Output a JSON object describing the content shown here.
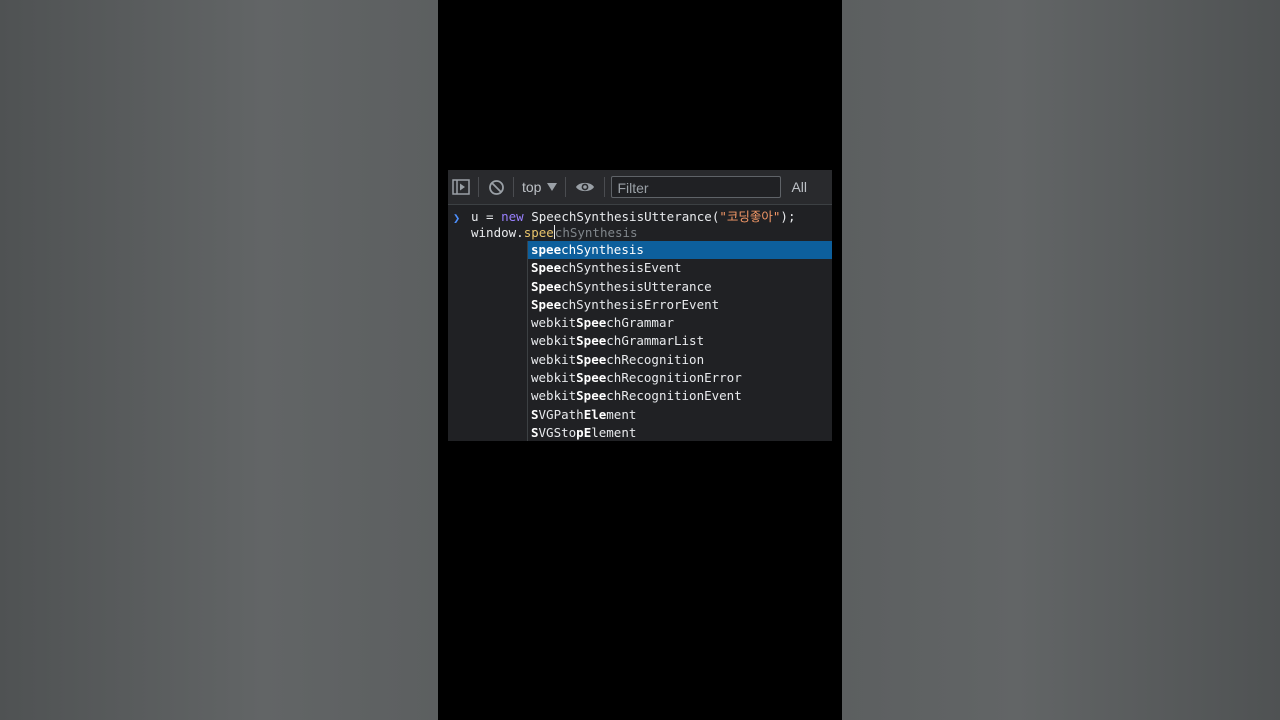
{
  "toolbar": {
    "context_label": "top",
    "filter_placeholder": "Filter",
    "levels_label": "All"
  },
  "console": {
    "line1": {
      "var": "u = ",
      "kw": "new",
      "ctor": " SpeechSynthesisUtterance(",
      "str": "\"코딩좋아\"",
      "end": ");"
    },
    "line2": {
      "prefix": "window.",
      "typed": "spee",
      "hint": "chSynthesis"
    }
  },
  "suggestions": [
    {
      "pre": "",
      "bold": "spee",
      "post": "chSynthesis",
      "selected": true
    },
    {
      "pre": "",
      "bold": "Spee",
      "post": "chSynthesisEvent"
    },
    {
      "pre": "",
      "bold": "Spee",
      "post": "chSynthesisUtterance"
    },
    {
      "pre": "",
      "bold": "Spee",
      "post": "chSynthesisErrorEvent"
    },
    {
      "pre": "webkit",
      "bold": "Spee",
      "post": "chGrammar"
    },
    {
      "pre": "webkit",
      "bold": "Spee",
      "post": "chGrammarList"
    },
    {
      "pre": "webkit",
      "bold": "Spee",
      "post": "chRecognition"
    },
    {
      "pre": "webkit",
      "bold": "Spee",
      "post": "chRecognitionError"
    },
    {
      "pre": "webkit",
      "bold": "Spee",
      "post": "chRecognitionEvent"
    },
    {
      "pre": "",
      "bold": "S",
      "post": "VGPath",
      "bold2": "Ele",
      "post2": "ment"
    },
    {
      "pre": "",
      "bold": "S",
      "post": "VGSto",
      "bold2": "pE",
      "post2": "lement"
    }
  ],
  "icons": [
    "sidebar-toggle-icon",
    "clear-console-icon",
    "dropdown-arrow-icon",
    "eye-icon"
  ],
  "colors": {
    "selection": "#0d5f9c",
    "keyword": "#9980ff",
    "string": "#f29766",
    "prompt": "#4d90fe"
  }
}
